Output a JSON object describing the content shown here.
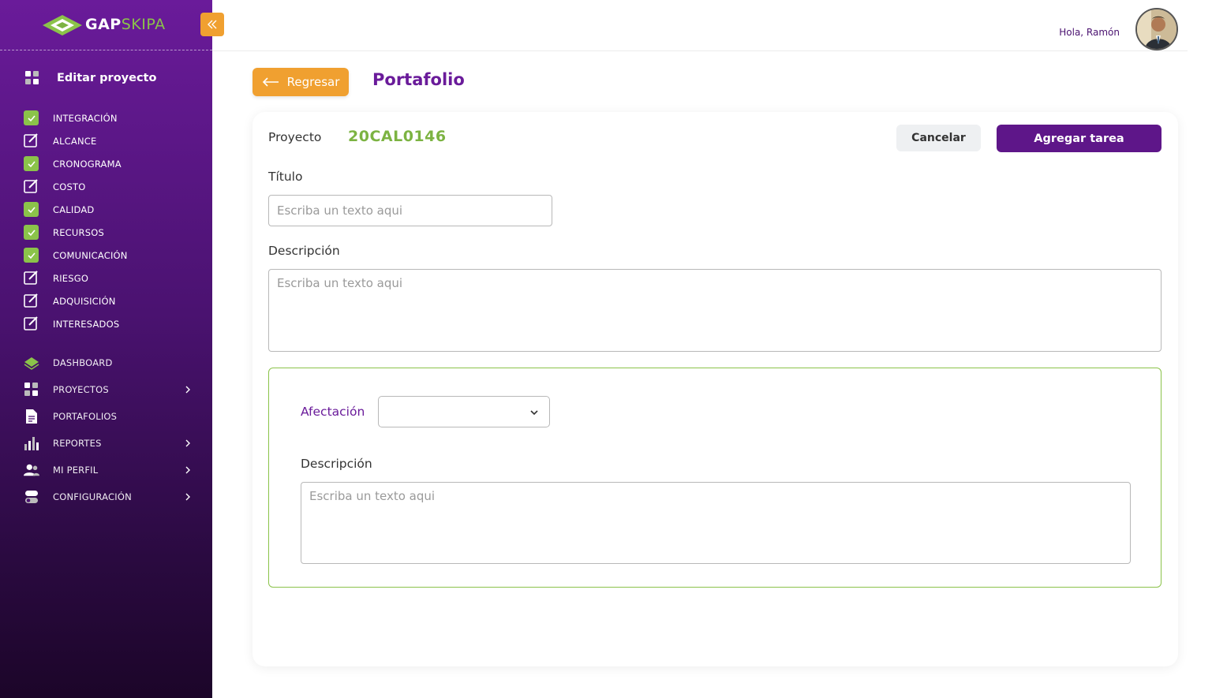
{
  "brand": {
    "name_bold": "GAP",
    "name_light": "SKIPA",
    "accent": "#6a1b9a",
    "green": "#8bc34a",
    "orange": "#f0a030"
  },
  "sidebar": {
    "collapse_icon": "double-chevron-left-icon",
    "edit_title": "Editar proyecto",
    "steps": [
      {
        "label": "INTEGRACIÓN",
        "status": "done"
      },
      {
        "label": "ALCANCE",
        "status": "edit"
      },
      {
        "label": "CRONOGRAMA",
        "status": "done"
      },
      {
        "label": "COSTO",
        "status": "edit"
      },
      {
        "label": "CALIDAD",
        "status": "done"
      },
      {
        "label": "RECURSOS",
        "status": "done"
      },
      {
        "label": "COMUNICACIÓN",
        "status": "done"
      },
      {
        "label": "RIESGO",
        "status": "edit"
      },
      {
        "label": "ADQUISICIÓN",
        "status": "edit"
      },
      {
        "label": "INTERESADOS",
        "status": "edit"
      }
    ],
    "menu": [
      {
        "label": "DASHBOARD",
        "icon": "layers-icon",
        "has_submenu": false
      },
      {
        "label": "PROYECTOS",
        "icon": "grid-icon",
        "has_submenu": true
      },
      {
        "label": "PORTAFOLIOS",
        "icon": "document-icon",
        "has_submenu": false
      },
      {
        "label": "REPORTES",
        "icon": "bar-chart-icon",
        "has_submenu": true
      },
      {
        "label": "MI PERFIL",
        "icon": "users-icon",
        "has_submenu": true
      },
      {
        "label": "CONFIGURACIÓN",
        "icon": "toggle-icon",
        "has_submenu": true
      }
    ]
  },
  "header": {
    "greeting": "Hola, Ramón"
  },
  "page": {
    "back_label": "Regresar",
    "title": "Portafolio"
  },
  "form": {
    "project_label": "Proyecto",
    "project_code": "20CAL0146",
    "cancel_label": "Cancelar",
    "add_label": "Agregar tarea",
    "title_label": "Título",
    "title_placeholder": "Escriba un texto aqui",
    "description_label": "Descripción",
    "description_placeholder": "Escriba un texto aqui",
    "afectacion_label": "Afectación",
    "afectacion_value": "",
    "afectacion_description_label": "Descripción",
    "afectacion_description_placeholder": "Escriba un texto aqui"
  }
}
